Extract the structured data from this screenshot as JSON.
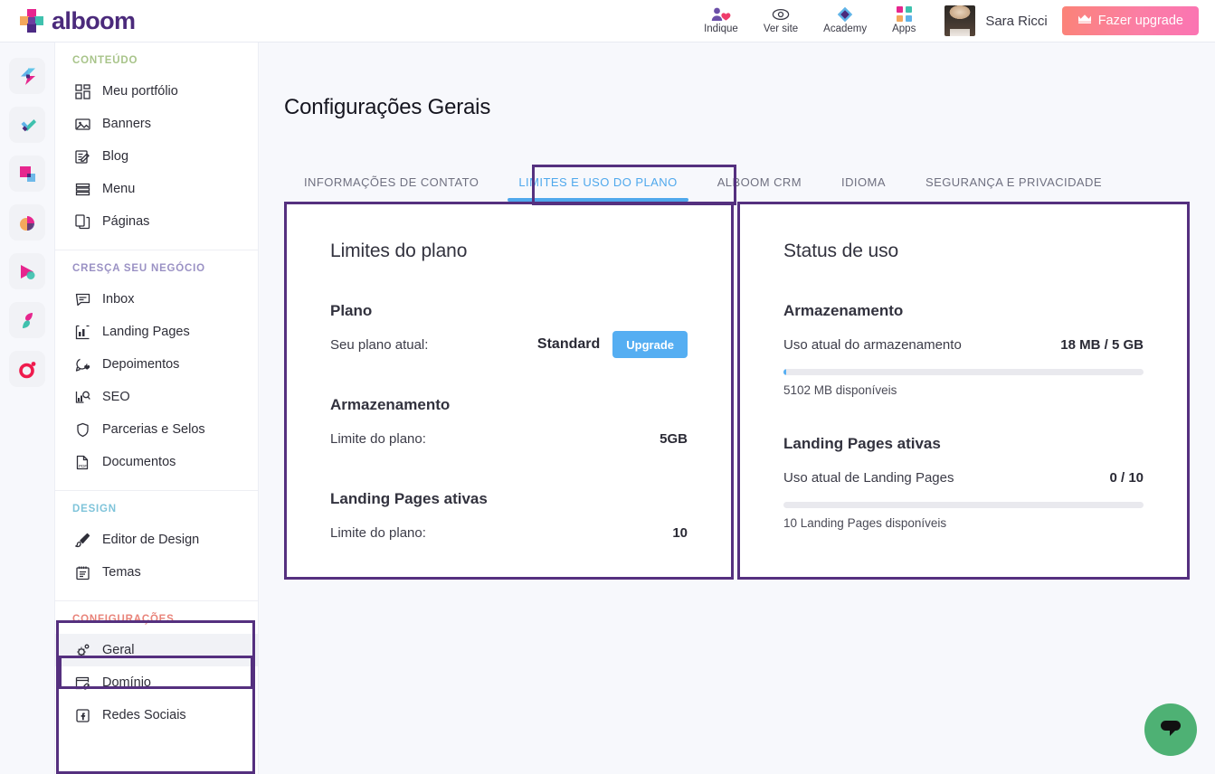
{
  "brand": {
    "name": "alboom"
  },
  "topbar": {
    "actions": [
      {
        "label": "Indique",
        "icon": "people-heart-icon"
      },
      {
        "label": "Ver site",
        "icon": "eye-icon"
      },
      {
        "label": "Academy",
        "icon": "diamond-icon"
      },
      {
        "label": "Apps",
        "icon": "grid-apps-icon"
      }
    ],
    "user_name": "Sara Ricci",
    "upgrade_label": "Fazer upgrade",
    "upgrade_icon": "crown-icon"
  },
  "rail": {
    "items": [
      {
        "name": "rail-icon-flash"
      },
      {
        "name": "rail-icon-check"
      },
      {
        "name": "rail-icon-squares"
      },
      {
        "name": "rail-icon-pie"
      },
      {
        "name": "rail-icon-play"
      },
      {
        "name": "rail-icon-leaf"
      },
      {
        "name": "rail-icon-target"
      }
    ]
  },
  "sidebar": {
    "groups": [
      {
        "title": "CONTEÚDO",
        "color": "#a8c48a",
        "items": [
          {
            "label": "Meu portfólio",
            "icon": "layout-icon",
            "active": false
          },
          {
            "label": "Banners",
            "icon": "image-icon",
            "active": false
          },
          {
            "label": "Blog",
            "icon": "edit-doc-icon",
            "active": false
          },
          {
            "label": "Menu",
            "icon": "lines-icon",
            "active": false
          },
          {
            "label": "Páginas",
            "icon": "pages-icon",
            "active": false
          }
        ]
      },
      {
        "title": "CRESÇA SEU NEGÓCIO",
        "color": "#9a91c4",
        "items": [
          {
            "label": "Inbox",
            "icon": "chat-box-icon",
            "active": false
          },
          {
            "label": "Landing Pages",
            "icon": "chart-bars-icon",
            "active": false
          },
          {
            "label": "Depoimentos",
            "icon": "chat-heart-icon",
            "active": false
          },
          {
            "label": "SEO",
            "icon": "seo-chart-icon",
            "active": false
          },
          {
            "label": "Parcerias e Selos",
            "icon": "badge-icon",
            "active": false
          },
          {
            "label": "Documentos",
            "icon": "pdf-icon",
            "active": false
          }
        ]
      },
      {
        "title": "DESIGN",
        "color": "#7fc4da",
        "items": [
          {
            "label": "Editor de Design",
            "icon": "brush-icon",
            "active": false
          },
          {
            "label": "Temas",
            "icon": "notepad-icon",
            "active": false
          }
        ]
      },
      {
        "title": "CONFIGURAÇÕES",
        "color": "#e8837a",
        "items": [
          {
            "label": "Geral",
            "icon": "gear-icon",
            "active": true
          },
          {
            "label": "Domínio",
            "icon": "domain-link-icon",
            "active": false
          },
          {
            "label": "Redes Sociais",
            "icon": "facebook-square-icon",
            "active": false
          }
        ]
      }
    ]
  },
  "main": {
    "page_title": "Configurações Gerais",
    "tabs": [
      {
        "label": "INFORMAÇÕES DE CONTATO",
        "active": false
      },
      {
        "label": "LIMITES E USO DO PLANO",
        "active": true
      },
      {
        "label": "ALBOOM CRM",
        "active": false
      },
      {
        "label": "IDIOMA",
        "active": false
      },
      {
        "label": "SEGURANÇA E PRIVACIDADE",
        "active": false
      }
    ],
    "limits_card": {
      "heading": "Limites do plano",
      "plan": {
        "section_title": "Plano",
        "row_label": "Seu plano atual:",
        "plan_name": "Standard",
        "button_label": "Upgrade"
      },
      "storage": {
        "section_title": "Armazenamento",
        "row_label": "Limite do plano:",
        "value": "5GB"
      },
      "landing": {
        "section_title": "Landing Pages ativas",
        "row_label": "Limite do plano:",
        "value": "10"
      }
    },
    "usage_card": {
      "heading": "Status de uso",
      "storage": {
        "section_title": "Armazenamento",
        "row_label": "Uso atual do armazenamento",
        "value": "18 MB / 5 GB",
        "percent": 0.35,
        "note": "5102 MB disponíveis"
      },
      "landing": {
        "section_title": "Landing Pages ativas",
        "row_label": "Uso atual de Landing Pages",
        "value": "0 / 10",
        "percent": 0,
        "note": "10 Landing Pages disponíveis"
      }
    }
  },
  "chat": {
    "icon": "chat-bubble-icon"
  },
  "colors": {
    "accent_blue": "#55aef2",
    "annotation_purple": "#55307f",
    "chat_green": "#4eb174",
    "brand_purple": "#4b2a7b"
  }
}
